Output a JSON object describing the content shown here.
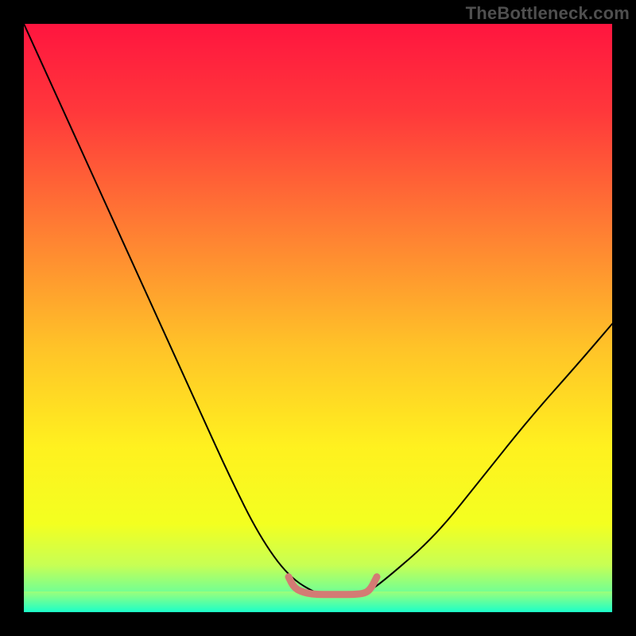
{
  "watermark": "TheBottleneck.com",
  "chart_data": {
    "type": "line",
    "title": "",
    "xlabel": "",
    "ylabel": "",
    "xlim": [
      0,
      100
    ],
    "ylim": [
      0,
      100
    ],
    "grid": false,
    "legend": false,
    "background_gradient": {
      "direction": "vertical",
      "stops": [
        {
          "pos": 0.0,
          "color": "#ff153f"
        },
        {
          "pos": 0.15,
          "color": "#ff383b"
        },
        {
          "pos": 0.35,
          "color": "#ff7e33"
        },
        {
          "pos": 0.55,
          "color": "#ffc328"
        },
        {
          "pos": 0.72,
          "color": "#fff11f"
        },
        {
          "pos": 0.85,
          "color": "#f3ff20"
        },
        {
          "pos": 0.92,
          "color": "#c7ff54"
        },
        {
          "pos": 0.97,
          "color": "#6aff9a"
        },
        {
          "pos": 1.0,
          "color": "#1cffc9"
        }
      ]
    },
    "bottom_green_band": {
      "from_y": 0.965,
      "to_y": 1.0,
      "color_top": "#9dff7a",
      "color_bottom": "#1cffc9"
    },
    "series": [
      {
        "name": "v-curve",
        "color": "#000000",
        "stroke_width": 2,
        "x": [
          0,
          5,
          10,
          15,
          20,
          25,
          30,
          35,
          40,
          45,
          50,
          52,
          55,
          58,
          62,
          70,
          78,
          86,
          94,
          100
        ],
        "values": [
          100,
          89,
          78,
          67,
          56,
          45,
          34,
          23,
          13,
          6,
          3,
          3,
          3,
          3,
          6,
          13,
          23,
          33,
          42,
          49
        ]
      }
    ],
    "highlight_region": {
      "name": "flat-minimum",
      "color": "#d37b74",
      "stroke_width": 9,
      "x": [
        45,
        46,
        48,
        50,
        52,
        54,
        56,
        58,
        59,
        60
      ],
      "values": [
        6,
        4,
        3.2,
        3,
        3,
        3,
        3,
        3.2,
        4,
        6
      ]
    }
  }
}
